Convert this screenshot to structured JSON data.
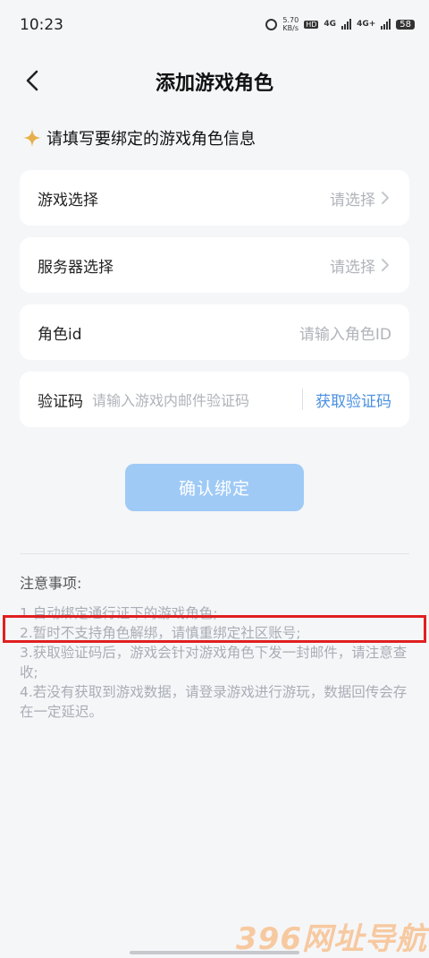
{
  "status_bar": {
    "time": "10:23",
    "speed_top": "5.70",
    "speed_bottom": "KB/s",
    "hd_label": "HD",
    "net1": "4G",
    "net2": "4G+",
    "battery": "58"
  },
  "header": {
    "title": "添加游戏角色"
  },
  "section": {
    "title": "请填写要绑定的游戏角色信息"
  },
  "form": {
    "game_select": {
      "label": "游戏选择",
      "value": "请选择"
    },
    "server_select": {
      "label": "服务器选择",
      "value": "请选择"
    },
    "role_id": {
      "label": "角色id",
      "placeholder": "请输入角色ID"
    },
    "verify_code": {
      "label": "验证码",
      "placeholder": "请输入游戏内邮件验证码",
      "action": "获取验证码"
    }
  },
  "confirm_button": "确认绑定",
  "notes": {
    "title": "注意事项:",
    "items": [
      "1.自动绑定通行证下的游戏角色;",
      "2.暂时不支持角色解绑，请慎重绑定社区账号;",
      "3.获取验证码后，游戏会针对游戏角色下发一封邮件，请注意查收;",
      "4.若没有获取到游戏数据，请登录游戏进行游玩，数据回传会存在一定延迟。"
    ]
  },
  "watermark": "396网址导航",
  "colors": {
    "accent": "#4a90e2",
    "button_disabled": "#9fcaf6",
    "highlight": "#e02020",
    "star": "#e8b04a"
  }
}
